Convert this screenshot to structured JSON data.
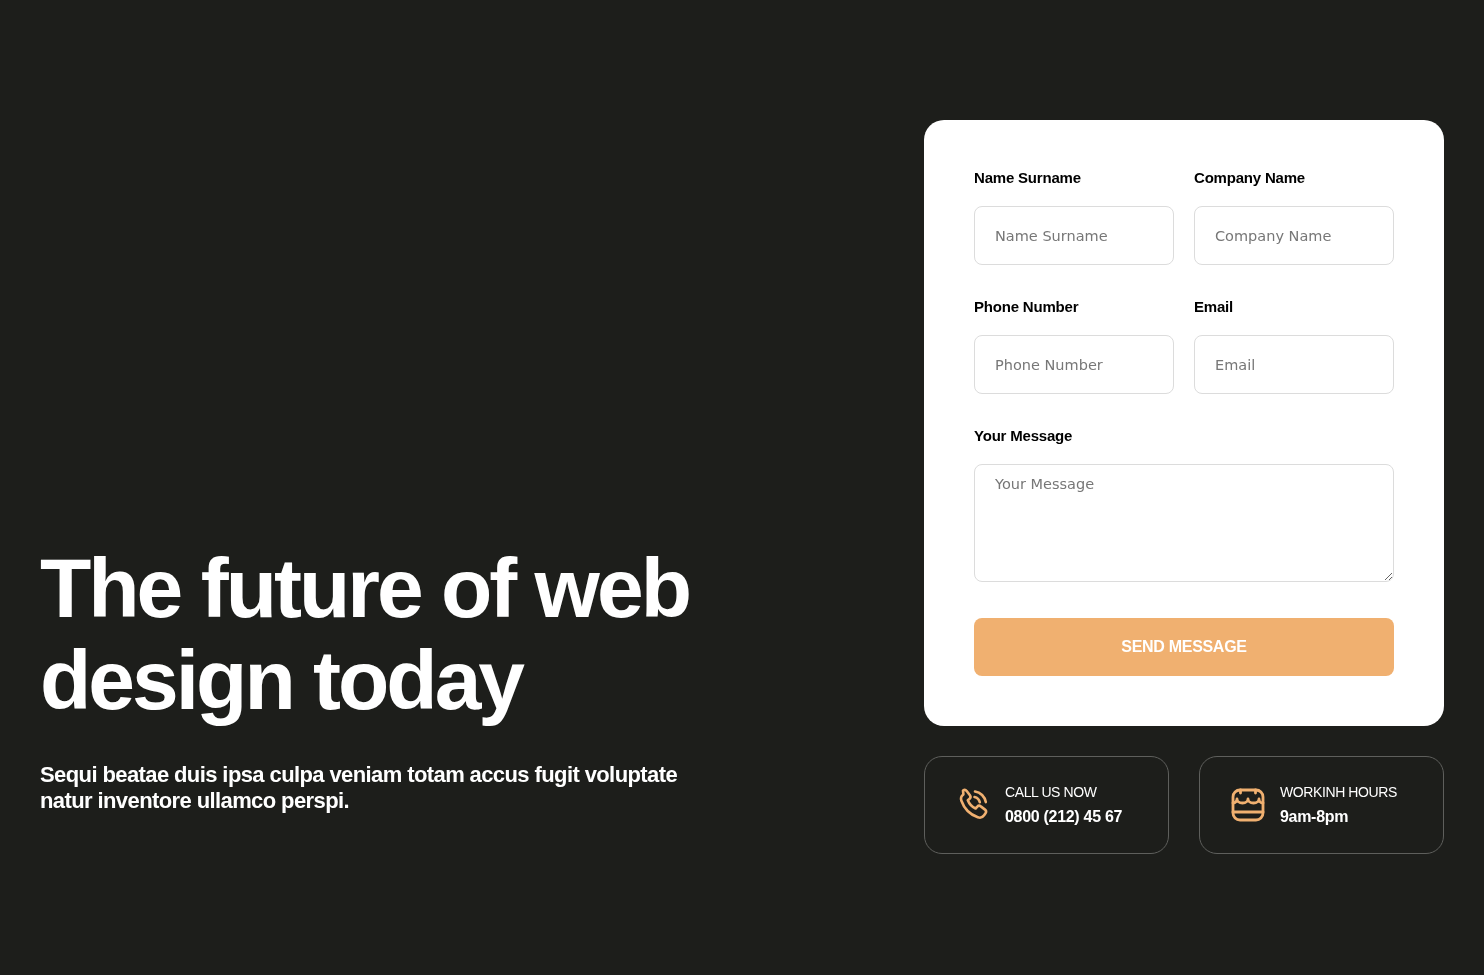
{
  "hero": {
    "title": "The future of web design today",
    "subtitle": "Sequi beatae duis ipsa culpa veniam totam accus fugit voluptate natur inventore ullamco perspi."
  },
  "form": {
    "fields": [
      {
        "kind": "input",
        "label": "Name Surname",
        "placeholder": "Name Surname"
      },
      {
        "kind": "input",
        "label": "Company Name",
        "placeholder": "Company Name"
      },
      {
        "kind": "input",
        "label": "Phone Number",
        "placeholder": "Phone Number"
      },
      {
        "kind": "input",
        "label": "Email",
        "placeholder": "Email"
      },
      {
        "kind": "textarea",
        "label": "Your Message",
        "placeholder": "Your Message"
      }
    ],
    "submit": "SEND MESSAGE"
  },
  "info_cards": [
    {
      "kind": "phone",
      "label": "CALL US NOW",
      "value": "0800 (212) 45 67"
    },
    {
      "kind": "hours",
      "label": "WORKINH HOURS",
      "value": "9am-8pm"
    }
  ]
}
